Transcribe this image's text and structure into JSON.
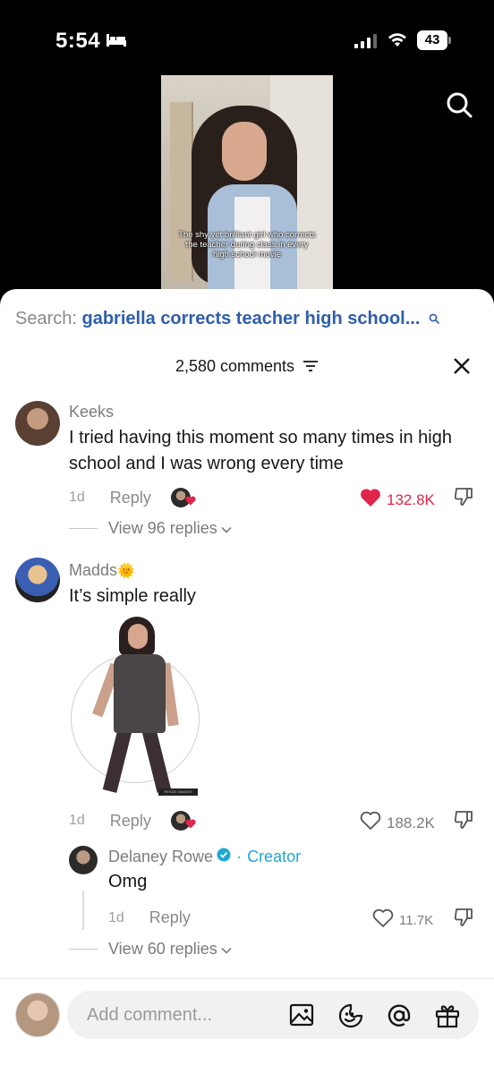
{
  "status_bar": {
    "time": "5:54",
    "battery": "43"
  },
  "video": {
    "caption": "The shy yet brilliant girl who corrects the teacher during class in every high school movie"
  },
  "search": {
    "label": "Search:",
    "query": "gabriella corrects teacher high school..."
  },
  "comments_header": {
    "count_label": "2,580 comments"
  },
  "comments": [
    {
      "username": "Keeks",
      "text": "I tried having this moment so many times in high school and I was wrong every time",
      "date": "1d",
      "reply_label": "Reply",
      "likes": "132.8K",
      "view_replies": "View 96 replies"
    },
    {
      "username": "Madds",
      "emoji": "🌞",
      "text": "It’s simple really",
      "date": "1d",
      "reply_label": "Reply",
      "likes": "188.2K",
      "view_replies": "View 60 replies",
      "reply": {
        "username": "Delaney Rowe",
        "separator": "·",
        "badge": "Creator",
        "text": "Omg",
        "date": "1d",
        "reply_label": "Reply",
        "likes": "11.7K"
      }
    }
  ],
  "gif": {
    "watermark": "RESIZE IMAGES"
  },
  "input": {
    "placeholder": "Add comment..."
  },
  "colors": {
    "liked": "#e0264c",
    "link": "#2f5eab",
    "creator": "#1fa8d3"
  },
  "icons": [
    "sleep-icon",
    "signal-icon",
    "wifi-icon",
    "battery-icon",
    "search-icon",
    "filter-icon",
    "close-icon",
    "heart-icon",
    "dislike-icon",
    "chevron-down-icon",
    "verified-icon",
    "image-icon",
    "emoji-icon",
    "mention-icon",
    "gift-icon"
  ]
}
